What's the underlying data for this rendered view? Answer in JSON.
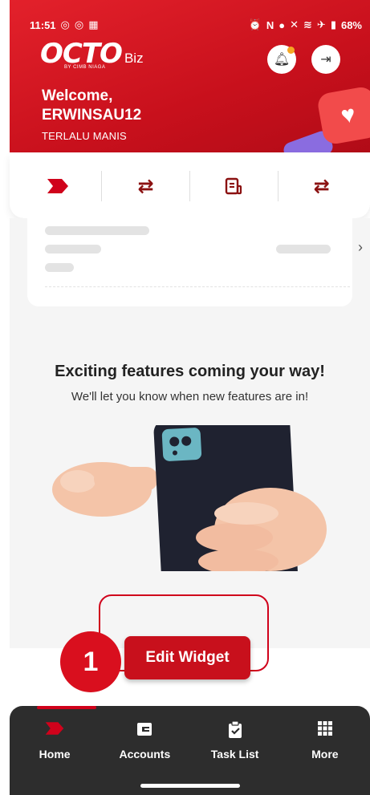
{
  "status_bar": {
    "time": "11:51",
    "battery": "68%",
    "icons_left": [
      "whatsapp-icon",
      "whatsapp-icon",
      "gallery-icon"
    ],
    "icons_right": [
      "alarm-icon",
      "nfc-icon",
      "location-icon",
      "mute-icon",
      "wifi-icon",
      "airplane-icon",
      "battery-icon"
    ]
  },
  "header": {
    "logo_text": "OCTO",
    "logo_suffix": "Biz",
    "logo_tagline": "BY CIMB NIAGA",
    "welcome": "Welcome,",
    "username": "ERWINSAU12",
    "company": "TERLALU MANIS"
  },
  "quick_menu": [
    {
      "icon": "octo-chevron-icon"
    },
    {
      "icon": "transfer-icon"
    },
    {
      "icon": "bill-icon"
    },
    {
      "icon": "transfer-icon"
    }
  ],
  "empty_state": {
    "title": "Exciting features coming your way!",
    "subtitle": "We'll let you know when new features are in!"
  },
  "edit_widget": {
    "label": "Edit Widget",
    "step": "1"
  },
  "bottom_nav": [
    {
      "label": "Home",
      "icon": "home-icon",
      "active": true
    },
    {
      "label": "Accounts",
      "icon": "wallet-icon",
      "active": false
    },
    {
      "label": "Task List",
      "icon": "clipboard-check-icon",
      "active": false
    },
    {
      "label": "More",
      "icon": "grid-icon",
      "active": false
    }
  ],
  "colors": {
    "brand_red": "#c8101c",
    "nav_bg": "#2d2d2d",
    "accent_dot": "#f5a623"
  }
}
